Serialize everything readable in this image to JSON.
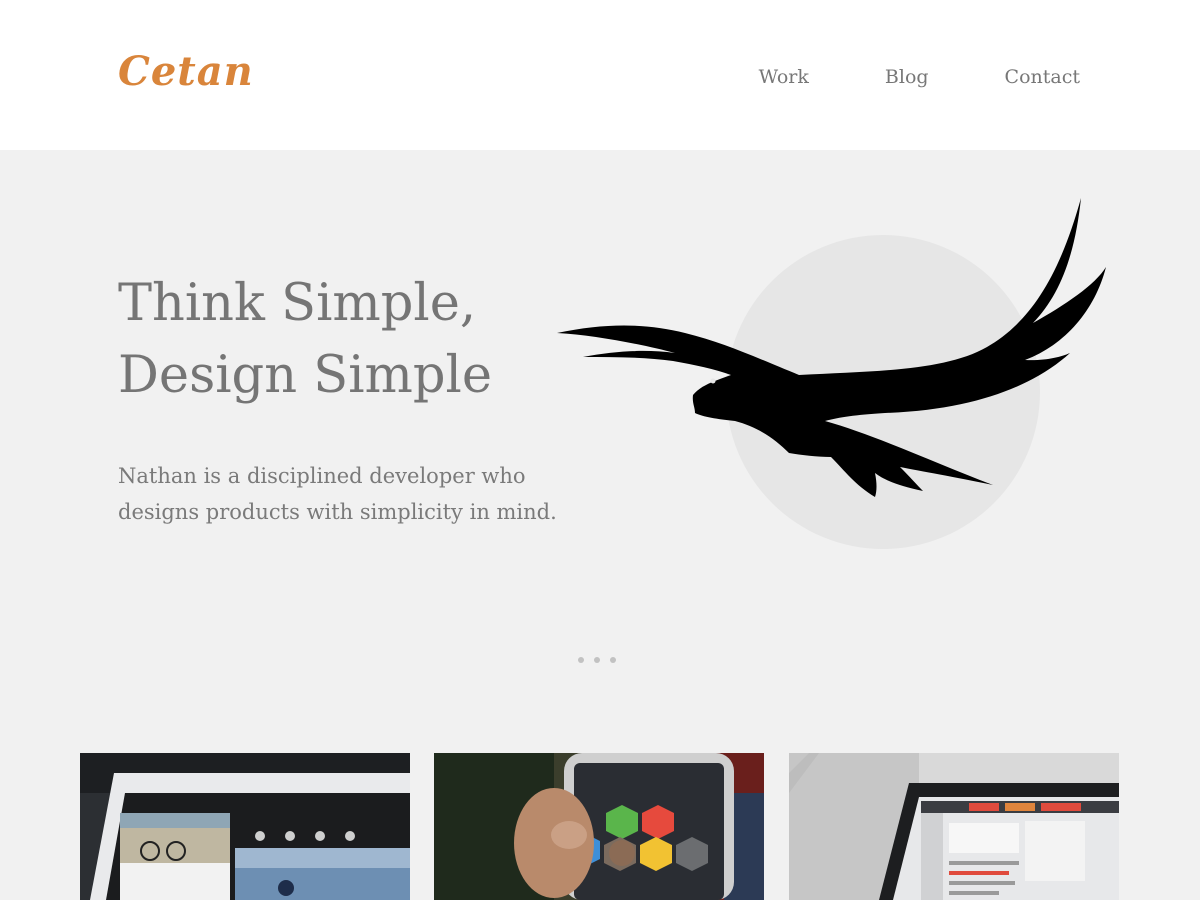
{
  "header": {
    "logo": "Cetan",
    "nav": [
      {
        "label": "Work"
      },
      {
        "label": "Blog"
      },
      {
        "label": "Contact"
      }
    ]
  },
  "hero": {
    "headline_line1": "Think Simple,",
    "headline_line2": "Design Simple",
    "tagline": "Nathan is a disciplined developer who designs products with simplicity in mind.",
    "pagination_count": 3
  },
  "portfolio": {
    "cards": [
      {
        "icon": "tablet-photo-app"
      },
      {
        "icon": "phone-social-app"
      },
      {
        "icon": "tablet-calendar-app"
      }
    ]
  },
  "colors": {
    "accent": "#d9853b",
    "background": "#f1f1f1",
    "text": "#757575"
  }
}
